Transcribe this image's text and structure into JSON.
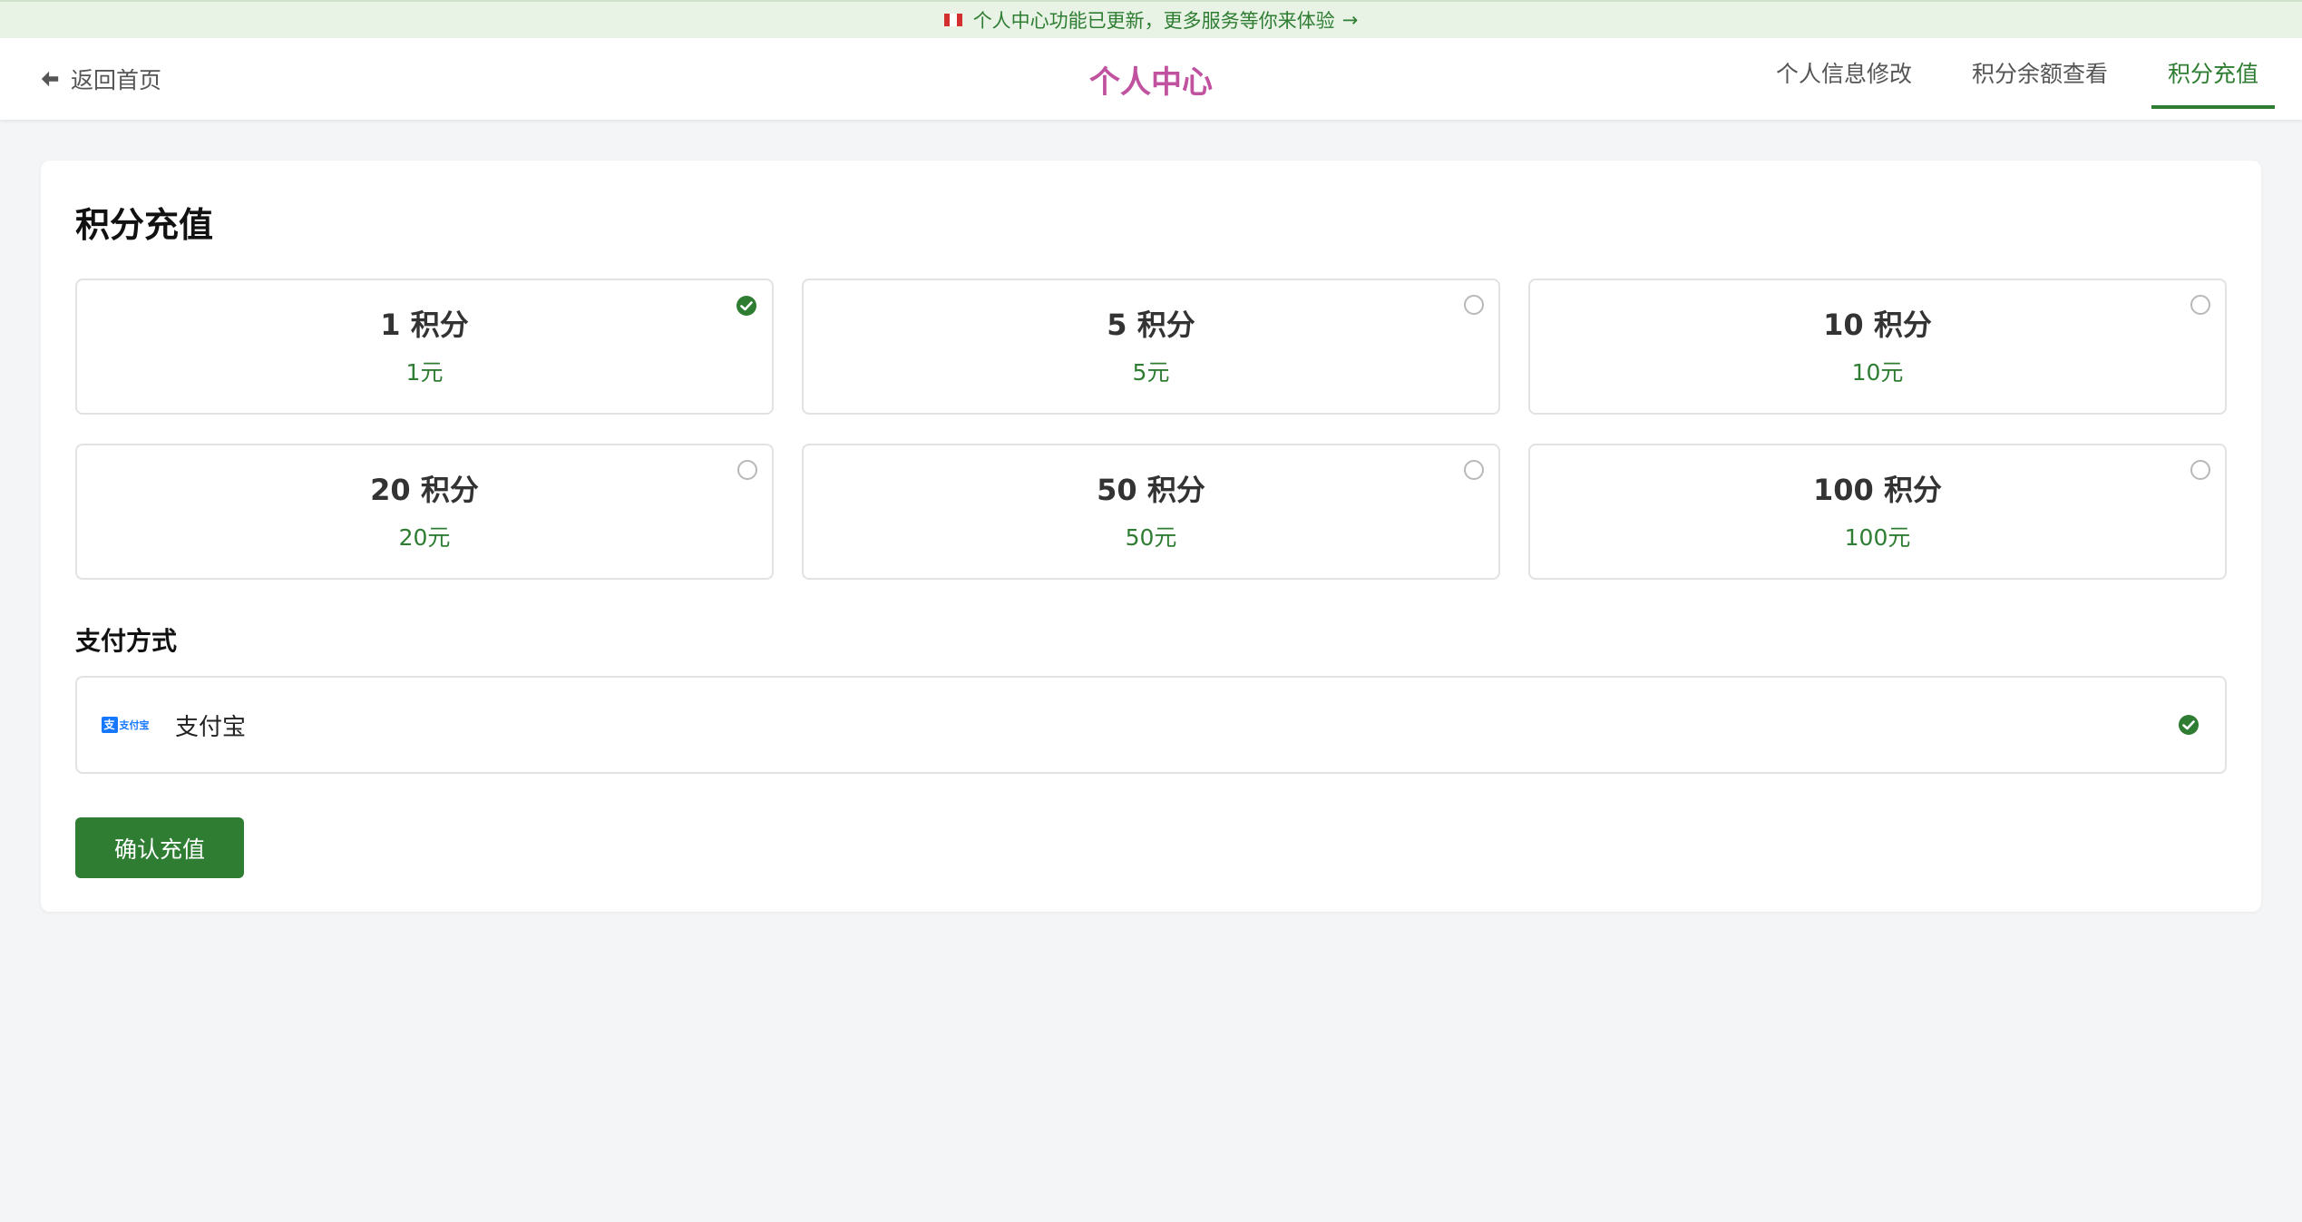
{
  "announcement": {
    "text": "个人中心功能已更新，更多服务等你来体验",
    "arrow": "→",
    "icon": "flag-icon"
  },
  "header": {
    "back_label": "返回首页",
    "title": "个人中心",
    "nav": [
      {
        "label": "个人信息修改",
        "active": false
      },
      {
        "label": "积分余额查看",
        "active": false
      },
      {
        "label": "积分充值",
        "active": true
      }
    ]
  },
  "recharge": {
    "title": "积分充值",
    "options": [
      {
        "points": "1 积分",
        "price": "1元",
        "selected": true
      },
      {
        "points": "5 积分",
        "price": "5元",
        "selected": false
      },
      {
        "points": "10 积分",
        "price": "10元",
        "selected": false
      },
      {
        "points": "20 积分",
        "price": "20元",
        "selected": false
      },
      {
        "points": "50 积分",
        "price": "50元",
        "selected": false
      },
      {
        "points": "100 积分",
        "price": "100元",
        "selected": false
      }
    ],
    "payment_label": "支付方式",
    "payment": {
      "name": "支付宝",
      "logo_mark": "支",
      "logo_text": "支付宝",
      "selected": true
    },
    "confirm_label": "确认充值"
  },
  "colors": {
    "accent": "#2e7d32",
    "title": "#c0529f",
    "announce_bg": "#e8f3e6",
    "page_bg": "#f4f5f7",
    "alipay_blue": "#1677ff"
  }
}
